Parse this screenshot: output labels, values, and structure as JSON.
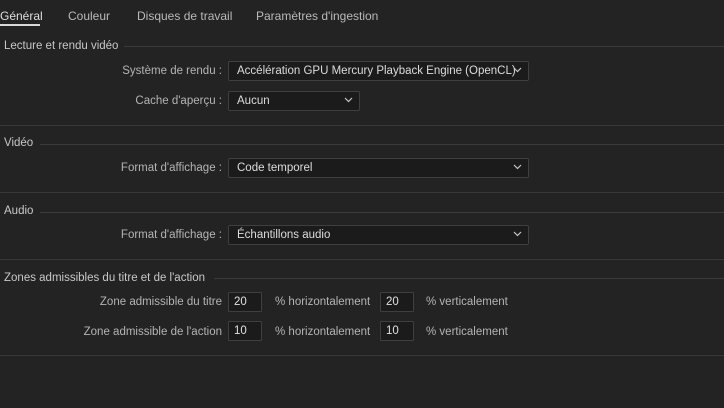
{
  "tabs": [
    {
      "label": "Général"
    },
    {
      "label": "Couleur"
    },
    {
      "label": "Disques de travail"
    },
    {
      "label": "Paramètres d'ingestion"
    }
  ],
  "playback": {
    "title": "Lecture et rendu vidéo",
    "renderer_label": "Système de rendu :",
    "renderer_value": "Accélération GPU Mercury Playback Engine (OpenCL)",
    "preview_cache_label": "Cache d'aperçu :",
    "preview_cache_value": "Aucun"
  },
  "video": {
    "title": "Vidéo",
    "display_format_label": "Format d'affichage :",
    "display_format_value": "Code temporel"
  },
  "audio": {
    "title": "Audio",
    "display_format_label": "Format d'affichage :",
    "display_format_value": "Échantillons audio"
  },
  "safe_zones": {
    "title": "Zones admissibles du titre et de l'action",
    "title_safe_label": "Zone admissible du titre",
    "title_safe_h": "20",
    "title_safe_v": "20",
    "action_safe_label": "Zone admissible de l'action",
    "action_safe_h": "10",
    "action_safe_v": "10",
    "horizontal_unit": "% horizontalement",
    "vertical_unit": "% verticalement"
  },
  "icons": {
    "dropdown": "chevron-down-icon"
  }
}
